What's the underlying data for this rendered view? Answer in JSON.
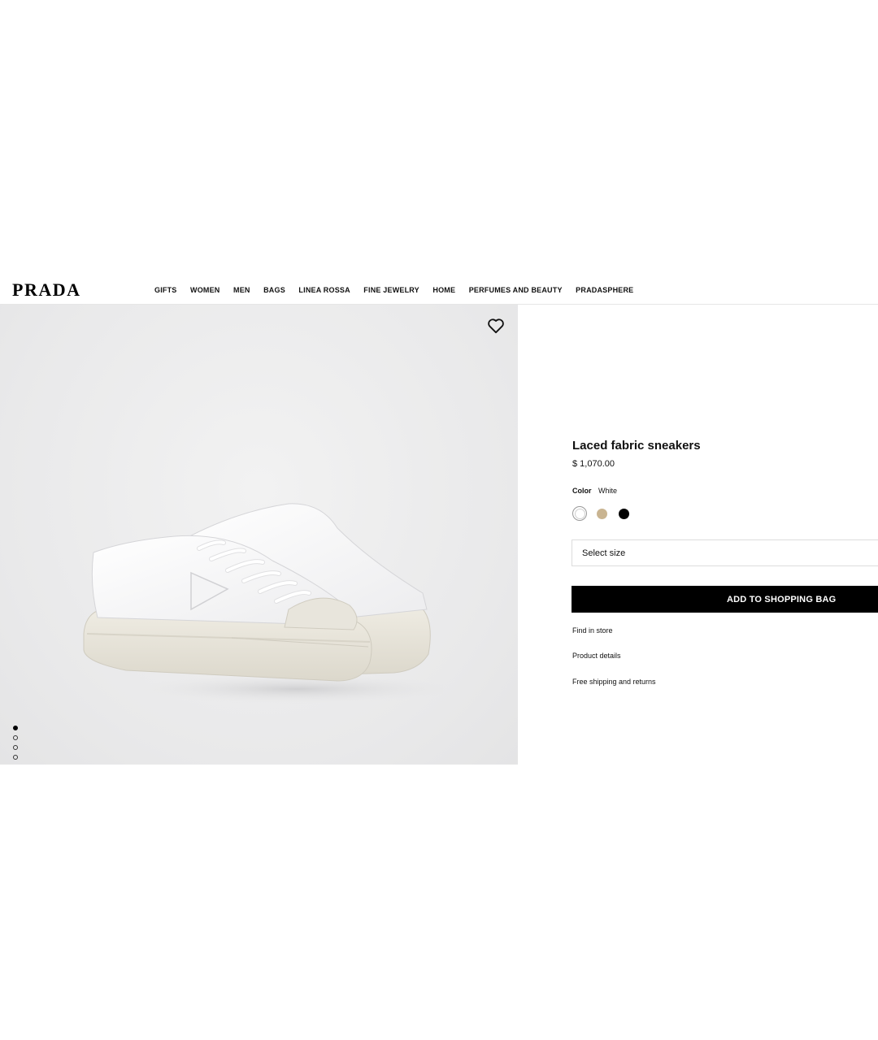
{
  "brand": {
    "logo_text": "PRADA"
  },
  "nav": {
    "items": [
      {
        "label": "GIFTS"
      },
      {
        "label": "WOMEN"
      },
      {
        "label": "MEN"
      },
      {
        "label": "BAGS"
      },
      {
        "label": "LINEA ROSSA"
      },
      {
        "label": "FINE JEWELRY"
      },
      {
        "label": "HOME"
      },
      {
        "label": "PERFUMES AND BEAUTY"
      },
      {
        "label": "PRADASPHERE"
      }
    ]
  },
  "gallery": {
    "wishlist_icon": "heart-icon",
    "image_count": 4,
    "active_index": 0
  },
  "product": {
    "title": "Laced fabric sneakers",
    "price": "$ 1,070.00",
    "color_label": "Color",
    "color_value": "White",
    "swatches": [
      {
        "name": "white",
        "hex": "#ffffff",
        "selected": true
      },
      {
        "name": "beige",
        "hex": "#c9b491",
        "selected": false
      },
      {
        "name": "black",
        "hex": "#000000",
        "selected": false
      }
    ],
    "size_placeholder": "Select size",
    "add_to_bag_label": "ADD TO SHOPPING BAG",
    "links": {
      "find_in_store": "Find in store",
      "product_details": "Product details",
      "shipping": "Free shipping and returns"
    }
  },
  "colors": {
    "accent": "#000000",
    "gallery_bg": "#e9e9ea"
  }
}
